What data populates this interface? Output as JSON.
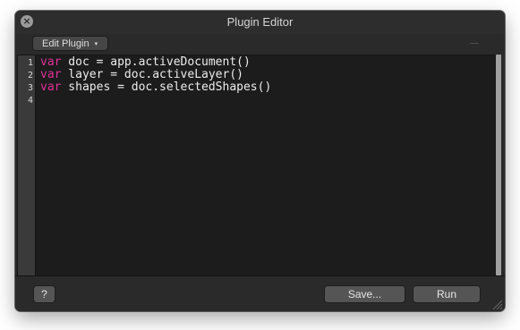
{
  "window": {
    "title": "Plugin Editor",
    "close_glyph": "×"
  },
  "toolbar": {
    "edit_plugin_label": "Edit Plugin",
    "edit_plugin_caret": "▾"
  },
  "editor": {
    "keyword_color": "#e0309a",
    "lines": [
      {
        "number": "1",
        "keyword": "var",
        "rest": " doc = app.activeDocument()"
      },
      {
        "number": "2",
        "keyword": "var",
        "rest": " layer = doc.activeLayer()"
      },
      {
        "number": "3",
        "keyword": "var",
        "rest": " shapes = doc.selectedShapes()"
      },
      {
        "number": "4",
        "keyword": "",
        "rest": ""
      }
    ]
  },
  "footer": {
    "help_label": "?",
    "save_label": "Save...",
    "run_label": "Run"
  },
  "icons": {
    "close": "close-icon",
    "dropdown": "chevron-down-icon",
    "resize": "resize-grip-icon"
  }
}
